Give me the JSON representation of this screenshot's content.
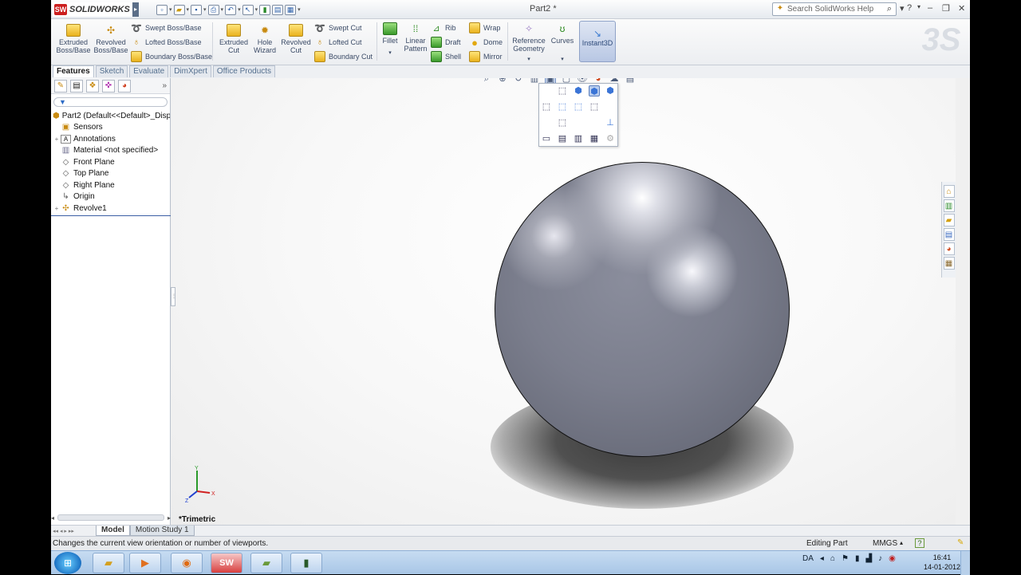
{
  "window": {
    "app_name": "SOLIDWORKS",
    "doc_title": "Part2 *",
    "help_search_placeholder": "Search SolidWorks Help"
  },
  "ribbon": {
    "extruded_boss": "Extruded Boss/Base",
    "revolved_boss": "Revolved Boss/Base",
    "swept_boss": "Swept Boss/Base",
    "lofted_boss": "Lofted Boss/Base",
    "boundary_boss": "Boundary Boss/Base",
    "extruded_cut": "Extruded Cut",
    "hole_wizard": "Hole Wizard",
    "revolved_cut": "Revolved Cut",
    "swept_cut": "Swept Cut",
    "lofted_cut": "Lofted Cut",
    "boundary_cut": "Boundary Cut",
    "fillet": "Fillet",
    "linear_pattern": "Linear Pattern",
    "rib": "Rib",
    "draft": "Draft",
    "shell": "Shell",
    "wrap": "Wrap",
    "dome": "Dome",
    "mirror": "Mirror",
    "reference_geometry": "Reference Geometry",
    "curves": "Curves",
    "instant3d": "Instant3D"
  },
  "command_tabs": [
    "Features",
    "Sketch",
    "Evaluate",
    "DimXpert",
    "Office Products"
  ],
  "feature_tree": {
    "root": "Part2  (Default<<Default>_Disp",
    "items": [
      {
        "label": "Sensors",
        "icon": "sensor-icon"
      },
      {
        "label": "Annotations",
        "icon": "annotations-icon"
      },
      {
        "label": "Material <not specified>",
        "icon": "material-icon"
      },
      {
        "label": "Front Plane",
        "icon": "plane-icon"
      },
      {
        "label": "Top Plane",
        "icon": "plane-icon"
      },
      {
        "label": "Right Plane",
        "icon": "plane-icon"
      },
      {
        "label": "Origin",
        "icon": "origin-icon"
      },
      {
        "label": "Revolve1",
        "icon": "revolve-icon"
      }
    ]
  },
  "viewport": {
    "view_name": "*Trimetric",
    "triad": {
      "x": "X",
      "y": "Y",
      "z": "Z"
    }
  },
  "bottom_tabs": [
    "Model",
    "Motion Study 1"
  ],
  "status": {
    "message": "Changes the current view orientation or number of viewports.",
    "mode": "Editing Part",
    "units": "MMGS"
  },
  "taskbar": {
    "lang": "DA",
    "time": "16:41",
    "date": "14-01-2012"
  },
  "colors": {
    "accent": "#2d4a7a",
    "sphere": "#7b7e8d"
  }
}
